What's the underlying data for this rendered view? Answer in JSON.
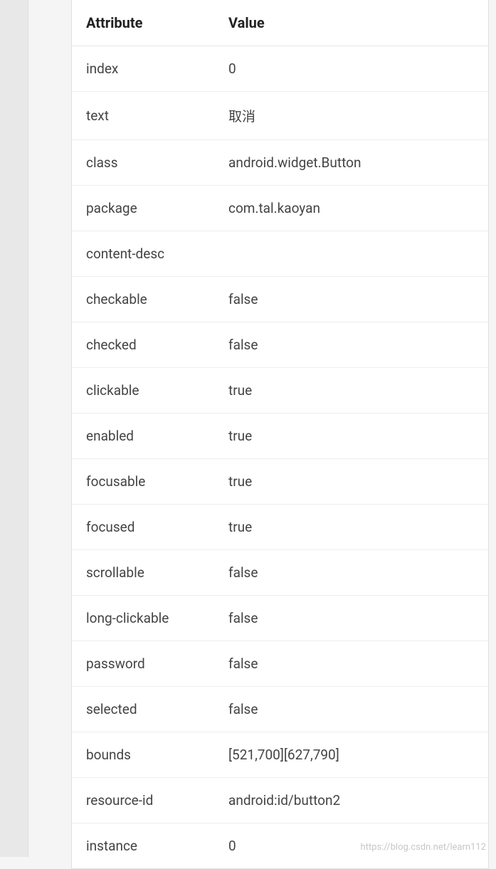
{
  "table": {
    "header": {
      "attr": "Attribute",
      "value": "Value"
    },
    "rows": [
      {
        "attr": "index",
        "value": "0"
      },
      {
        "attr": "text",
        "value": "取消"
      },
      {
        "attr": "class",
        "value": "android.widget.Button"
      },
      {
        "attr": "package",
        "value": "com.tal.kaoyan"
      },
      {
        "attr": "content-desc",
        "value": ""
      },
      {
        "attr": "checkable",
        "value": "false"
      },
      {
        "attr": "checked",
        "value": "false"
      },
      {
        "attr": "clickable",
        "value": "true"
      },
      {
        "attr": "enabled",
        "value": "true"
      },
      {
        "attr": "focusable",
        "value": "true"
      },
      {
        "attr": "focused",
        "value": "true"
      },
      {
        "attr": "scrollable",
        "value": "false"
      },
      {
        "attr": "long-clickable",
        "value": "false"
      },
      {
        "attr": "password",
        "value": "false"
      },
      {
        "attr": "selected",
        "value": "false"
      },
      {
        "attr": "bounds",
        "value": "[521,700][627,790]"
      },
      {
        "attr": "resource-id",
        "value": "android:id/button2"
      },
      {
        "attr": "instance",
        "value": "0"
      }
    ]
  },
  "watermark": "https://blog.csdn.net/learn112"
}
